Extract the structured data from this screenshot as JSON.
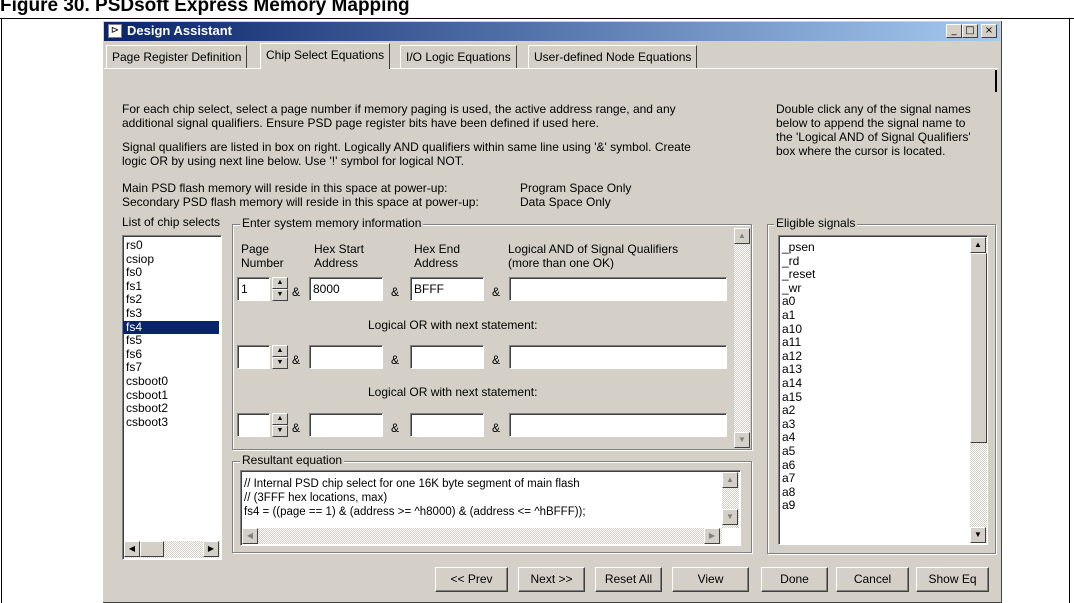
{
  "doc": {
    "caption": "Figure 30. PSDsoft Express Memory Mapping"
  },
  "window": {
    "title": "Design Assistant",
    "icon_glyph": "⊳",
    "minimize": "_",
    "maximize": "□",
    "close": "×"
  },
  "tabs": [
    {
      "label": "Page Register Definition"
    },
    {
      "label": "Chip Select Equations"
    },
    {
      "label": "I/O Logic Equations"
    },
    {
      "label": "User-defined Node Equations"
    }
  ],
  "instructions": {
    "line1": "For each chip select, select a page number if memory paging is used, the active address range, and any",
    "line2": "additional signal qualifiers. Ensure PSD page register bits have been defined if used here.",
    "line3": "Signal qualifiers are listed in box on right. Logically AND qualifiers within same line using '&' symbol. Create",
    "line4": "logic OR by using next line below. Use '!' symbol for logical NOT.",
    "main_label": "Main PSD flash memory will reside in this space at power-up:",
    "main_value": "Program Space Only",
    "secondary_label": "Secondary PSD flash memory will reside in this space at power-up:",
    "secondary_value": "Data Space Only"
  },
  "help_right": {
    "line1": "Double click any of the signal names",
    "line2": "below to append the signal name to",
    "line3": "the 'Logical AND of Signal Qualifiers'",
    "line4": "box where the cursor is located."
  },
  "chip_selects": {
    "label": "List of chip selects",
    "items": [
      "rs0",
      "csiop",
      "fs0",
      "fs1",
      "fs2",
      "fs3",
      "fs4",
      "fs5",
      "fs6",
      "fs7",
      "csboot0",
      "csboot1",
      "csboot2",
      "csboot3"
    ],
    "selected": "fs4"
  },
  "memory": {
    "group_label": "Enter system memory information",
    "col_page_1": "Page",
    "col_page_2": "Number",
    "col_start_1": "Hex Start",
    "col_start_2": "Address",
    "col_end_1": "Hex End",
    "col_end_2": "Address",
    "col_qual_1": "Logical AND of Signal Qualifiers",
    "col_qual_2": "(more than one OK)",
    "amp": "&",
    "or_label": "Logical OR with next statement:",
    "rows": [
      {
        "page": "1",
        "start": "8000",
        "end": "BFFF",
        "qualifiers": ""
      },
      {
        "page": "",
        "start": "",
        "end": "",
        "qualifiers": ""
      },
      {
        "page": "",
        "start": "",
        "end": "",
        "qualifiers": ""
      }
    ]
  },
  "equation": {
    "label": "Resultant equation",
    "line1": "// Internal PSD chip select for one 16K byte segment of main flash",
    "line2": "// (3FFF hex locations, max)",
    "line3": "fs4 = ((page == 1) & (address >= ^h8000) & (address <= ^hBFFF));"
  },
  "signals": {
    "label": "Eligible signals",
    "items": [
      "_psen",
      "_rd",
      "_reset",
      "_wr",
      "a0",
      "a1",
      "a10",
      "a11",
      "a12",
      "a13",
      "a14",
      "a15",
      "a2",
      "a3",
      "a4",
      "a5",
      "a6",
      "a7",
      "a8",
      "a9"
    ]
  },
  "buttons": {
    "prev": "<< Prev",
    "next": "Next >>",
    "reset_all": "Reset All",
    "view": "View",
    "done": "Done",
    "cancel": "Cancel",
    "show_eq": "Show Eq"
  },
  "arrows": {
    "up": "▲",
    "down": "▼",
    "left": "◀",
    "right": "▶"
  }
}
